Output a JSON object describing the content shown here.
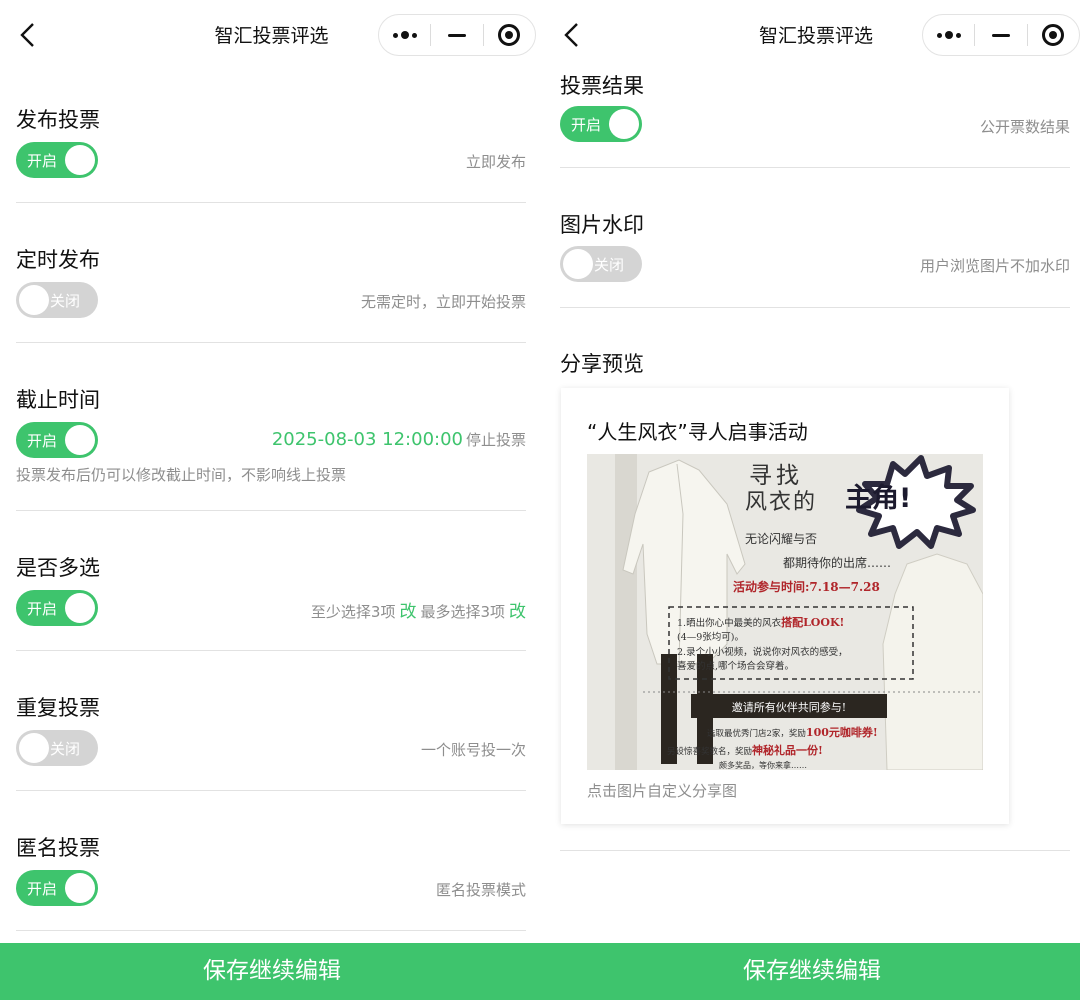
{
  "left": {
    "nav_title": "智汇投票评选",
    "rows": [
      {
        "title": "发布投票",
        "toggle": "开启",
        "desc": "立即发布"
      },
      {
        "title": "定时发布",
        "toggle": "关闭",
        "desc": "无需定时，立即开始投票"
      },
      {
        "title": "截止时间",
        "toggle": "开启",
        "datetime": "2025-08-03  12:00:00",
        "desc": "停止投票",
        "note": "投票发布后仍可以修改截止时间，不影响线上投票"
      },
      {
        "title": "是否多选",
        "toggle": "开启",
        "min_text": "至少选择3项",
        "max_text": "最多选择3项",
        "edit": "改"
      },
      {
        "title": "重复投票",
        "toggle": "关闭",
        "desc": "一个账号投一次"
      },
      {
        "title": "匿名投票",
        "toggle": "开启",
        "desc": "匿名投票模式"
      }
    ],
    "save_button": "保存继续编辑"
  },
  "right": {
    "nav_title": "智汇投票评选",
    "rows": [
      {
        "title": "投票结果",
        "toggle": "开启",
        "desc": "公开票数结果"
      },
      {
        "title": "图片水印",
        "toggle": "关闭",
        "desc": "用户浏览图片不加水印"
      }
    ],
    "share": {
      "section_title": "分享预览",
      "card_title": "“人生风衣”寻人启事活动",
      "hint": "点击图片自定义分享图",
      "poster": {
        "headline_1": "寻找",
        "headline_2": "风衣的",
        "badge": "主角!",
        "line_1": "无论闪耀与否",
        "line_2": "都期待你的出席……",
        "period": "活动参与时间:7.18—7.28",
        "rule_1a": "1.晒出你心中最美的风衣",
        "rule_1b": "搭配LOOK!",
        "rule_1c": "(4—9张均可)。",
        "rule_2a": "2.录个小小视频，说说你对风衣的感受，",
        "rule_2b": "喜爱的点,哪个场合会穿着。",
        "banner": "邀请所有伙伴共同参与!",
        "prize_1a": "选取最优秀门店2家，奖励",
        "prize_1b": "100元咖啡券!",
        "prize_2a": "另设惊喜奖数名，奖励",
        "prize_2b": "神秘礼品一份!",
        "prize_3": "颇多奖品，等你来拿……"
      }
    },
    "save_button": "保存继续编辑"
  },
  "colors": {
    "accent": "#3ec46d",
    "toggle_off": "#d4d4d4",
    "muted_text": "#8e8e8e",
    "divider": "#e2e2e2",
    "poster_red": "#b0252a"
  },
  "icons": [
    "back-chevron-icon",
    "more-dots-icon",
    "minimize-icon",
    "close-target-icon"
  ]
}
